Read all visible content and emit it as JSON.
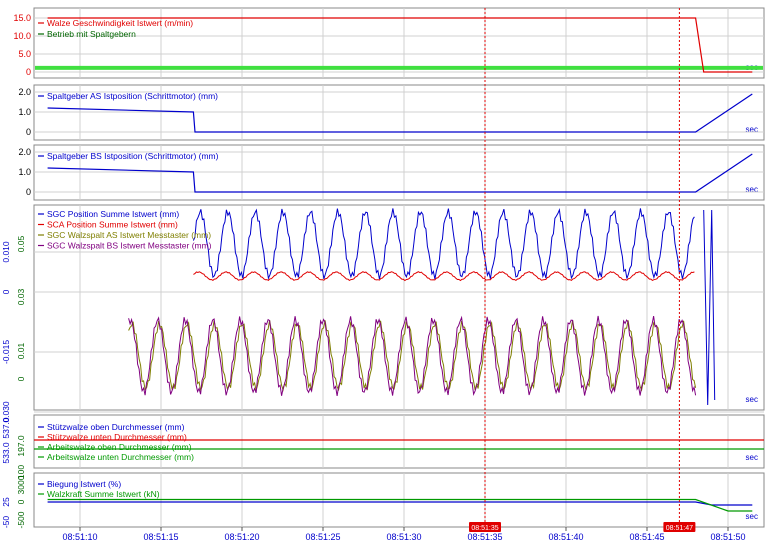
{
  "x_axis": {
    "unit_label": "sec",
    "ticks": [
      "08:51:10",
      "08:51:15",
      "08:51:20",
      "08:51:25",
      "08:51:30",
      "08:51:35",
      "08:51:40",
      "08:51:45",
      "08:51:50"
    ],
    "cursor_labels": [
      "08:51:35",
      "08:51:47"
    ]
  },
  "colors": {
    "red": "#e00000",
    "blue": "#0000cc",
    "darkgreen": "#006600",
    "green": "#009900",
    "olive": "#7f7f00",
    "purple": "#800080",
    "band": "#40e040",
    "grid": "#d0d0d0"
  },
  "chart_data": [
    {
      "type": "line",
      "panel": 1,
      "y_ticks": [
        "15.0",
        "10.0",
        "5.0",
        "0"
      ],
      "ylim": [
        0,
        15
      ],
      "legend": [
        {
          "label": "Walze Geschwindigkeit Istwert (m/min)",
          "color": "red"
        },
        {
          "label": "Betrieb mit Spaltgebern",
          "color": "darkgreen"
        }
      ],
      "series": [
        {
          "name": "Walze Geschwindigkeit Istwert (m/min)",
          "values_note": "",
          "x": [
            "08:51:08",
            "08:51:48",
            "08:51:48.5",
            "08:51:51.5"
          ],
          "y": [
            15,
            15,
            0,
            0
          ]
        },
        {
          "name": "Betrieb mit Spaltgebern",
          "x": [
            "08:51:08",
            "08:51:51.5"
          ],
          "y": [
            1,
            1
          ]
        }
      ]
    },
    {
      "type": "line",
      "panel": 2,
      "y_ticks": [
        "2.0",
        "1.0",
        "0"
      ],
      "ylim": [
        0,
        2.2
      ],
      "legend": [
        {
          "label": "Spaltgeber AS Istposition (Schrittmotor) (mm)",
          "color": "blue"
        }
      ],
      "series": [
        {
          "name": "Spaltgeber AS Istposition (Schrittmotor) (mm)",
          "x": [
            "08:51:08",
            "08:51:17",
            "08:51:17.1",
            "08:51:48",
            "08:51:51.5"
          ],
          "y": [
            1.2,
            1.0,
            0,
            0,
            1.9
          ]
        }
      ]
    },
    {
      "type": "line",
      "panel": 3,
      "y_ticks": [
        "2.0",
        "1.0",
        "0"
      ],
      "ylim": [
        0,
        2.2
      ],
      "legend": [
        {
          "label": "Spaltgeber BS Istposition (Schrittmotor) (mm)",
          "color": "blue"
        }
      ],
      "series": [
        {
          "name": "Spaltgeber BS Istposition (Schrittmotor) (mm)",
          "x": [
            "08:51:08",
            "08:51:17",
            "08:51:17.1",
            "08:51:48",
            "08:51:51.5"
          ],
          "y": [
            1.2,
            1.0,
            0,
            0,
            1.9
          ]
        }
      ]
    },
    {
      "type": "line",
      "panel": 4,
      "y_ticks_left": [
        "0.010",
        "0",
        "-0.015",
        "0.030"
      ],
      "y_ticks_right": [
        "0.05",
        "0.03",
        "0.01",
        "0"
      ],
      "legend": [
        {
          "label": "SGC Position Summe Istwert (mm)",
          "color": "blue"
        },
        {
          "label": "SCA Position Summe Istwert (mm)",
          "color": "red"
        },
        {
          "label": "SGC Walzspalt AS Istwert Messtaster (mm)",
          "color": "olive"
        },
        {
          "label": "SGC Walzspalt BS Istwert Messtaster (mm)",
          "color": "purple"
        }
      ],
      "series": [
        {
          "name": "SGC Position Summe Istwert (mm)",
          "start": "08:51:17",
          "end": "08:51:48",
          "period_s": 1.7,
          "level": 0.012,
          "amplitude": 0.008
        },
        {
          "name": "SCA Position Summe Istwert (mm)",
          "start": "08:51:17",
          "end": "08:51:48",
          "period_s": 1.7,
          "level": 0.004,
          "amplitude": 0.001
        },
        {
          "name": "SGC Walzspalt AS Istwert Messtaster (mm)",
          "start": "08:51:13",
          "end": "08:51:48",
          "period_s": 1.7,
          "level": -0.016,
          "amplitude": 0.008
        },
        {
          "name": "SGC Walzspalt BS Istwert Messtaster (mm)",
          "start": "08:51:13",
          "end": "08:51:48",
          "period_s": 1.7,
          "level": -0.016,
          "amplitude": 0.009
        }
      ]
    },
    {
      "type": "line",
      "panel": 5,
      "y_ticks": [
        "537.0",
        "533.0",
        "197.0",
        "100"
      ],
      "legend": [
        {
          "label": "Stützwalze oben Durchmesser (mm)",
          "color": "blue"
        },
        {
          "label": "Stützwalze unten Durchmesser (mm)",
          "color": "red"
        },
        {
          "label": "Arbeitswalze oben Durchmesser (mm)",
          "color": "green"
        },
        {
          "label": "Arbeitswalze unten Durchmesser (mm)",
          "color": "green"
        }
      ],
      "series": [
        {
          "name": "Stützwalze unten Durchmesser (mm)",
          "x": [
            "08:51:08",
            "08:51:51.5"
          ],
          "y": [
            533,
            533
          ]
        },
        {
          "name": "Arbeitswalze oben Durchmesser (mm)",
          "x": [
            "08:51:08",
            "08:51:51.5"
          ],
          "y": [
            197,
            197
          ]
        }
      ]
    },
    {
      "type": "line",
      "panel": 6,
      "y_ticks_left": [
        "25",
        "-50"
      ],
      "y_ticks_right": [
        "3000",
        "0",
        "-500"
      ],
      "legend": [
        {
          "label": "Biegung Istwert (%)",
          "color": "blue"
        },
        {
          "label": "Walzkraft Summe Istwert (kN)",
          "color": "green"
        }
      ],
      "series": [
        {
          "name": "Biegung Istwert (%)",
          "x": [
            "08:51:08",
            "08:51:48",
            "08:51:49",
            "08:51:51.5"
          ],
          "y": [
            0.3,
            0.3,
            0.0,
            0.0
          ]
        },
        {
          "name": "Walzkraft Summe Istwert (kN)",
          "x": [
            "08:51:08",
            "08:51:48",
            "08:51:50",
            "08:51:51.5"
          ],
          "y": [
            0.55,
            0.55,
            -0.6,
            -0.6
          ]
        }
      ]
    }
  ]
}
